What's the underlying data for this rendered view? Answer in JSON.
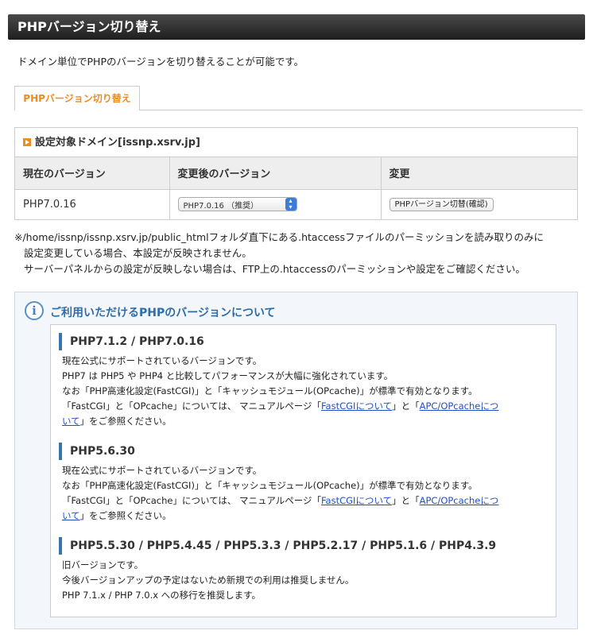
{
  "page_title": "PHPバージョン切り替え",
  "intro": "ドメイン単位でPHPのバージョンを切り替えることが可能です。",
  "tab_label": "PHPバージョン切り替え",
  "domain": {
    "heading": "設定対象ドメイン[issnp.xsrv.jp]",
    "columns": [
      "現在のバージョン",
      "変更後のバージョン",
      "変更"
    ],
    "current_version": "PHP7.0.16",
    "select_value": "PHP7.0.16 （推奨）",
    "button_label": "PHPバージョン切替(確認)"
  },
  "notes": {
    "line1": "※/home/issnp/issnp.xsrv.jp/public_htmlフォルダ直下にある.htaccessファイルのパーミッションを読み取りのみに",
    "line2": "設定変更している場合、本設定が反映されません。",
    "line3": "サーバーパネルからの設定が反映しない場合は、FTP上の.htaccessのパーミッションや設定をご確認ください。"
  },
  "info": {
    "title": "ご利用いただけるPHPのバージョンについて",
    "sections": [
      {
        "heading": "PHP7.1.2 / PHP7.0.16",
        "line1": "現在公式にサポートされているバージョンです。",
        "line2": "PHP7 は PHP5 や PHP4 と比較してパフォーマンスが大幅に強化されています。",
        "line3": "なお「PHP高速化設定(FastCGI)」と「キャッシュモジュール(OPcache)」が標準で有効となります。",
        "line4_pre": "「FastCGI」と「OPcache」については、 マニュアルページ「",
        "link1": "FastCGIについて",
        "line4_mid": "」と「",
        "link2a": "APC/OPcacheにつ",
        "link2b": "いて",
        "line5_post": "」をご参照ください。"
      },
      {
        "heading": "PHP5.6.30",
        "line1": "現在公式にサポートされているバージョンです。",
        "line2": "なお「PHP高速化設定(FastCGI)」と「キャッシュモジュール(OPcache)」が標準で有効となります。",
        "line3_pre": "「FastCGI」と「OPcache」については、 マニュアルページ「",
        "link1": "FastCGIについて",
        "line3_mid": "」と「",
        "link2a": "APC/OPcacheにつ",
        "link2b": "いて",
        "line4_post": "」をご参照ください。"
      },
      {
        "heading": "PHP5.5.30 / PHP5.4.45 / PHP5.3.3 / PHP5.2.17 / PHP5.1.6 / PHP4.3.9",
        "line1": "旧バージョンです。",
        "line2": "今後バージョンアップの予定はないため新規での利用は推奨しません。",
        "line3": "PHP 7.1.x / PHP 7.0.x への移行を推奨します。"
      }
    ]
  }
}
